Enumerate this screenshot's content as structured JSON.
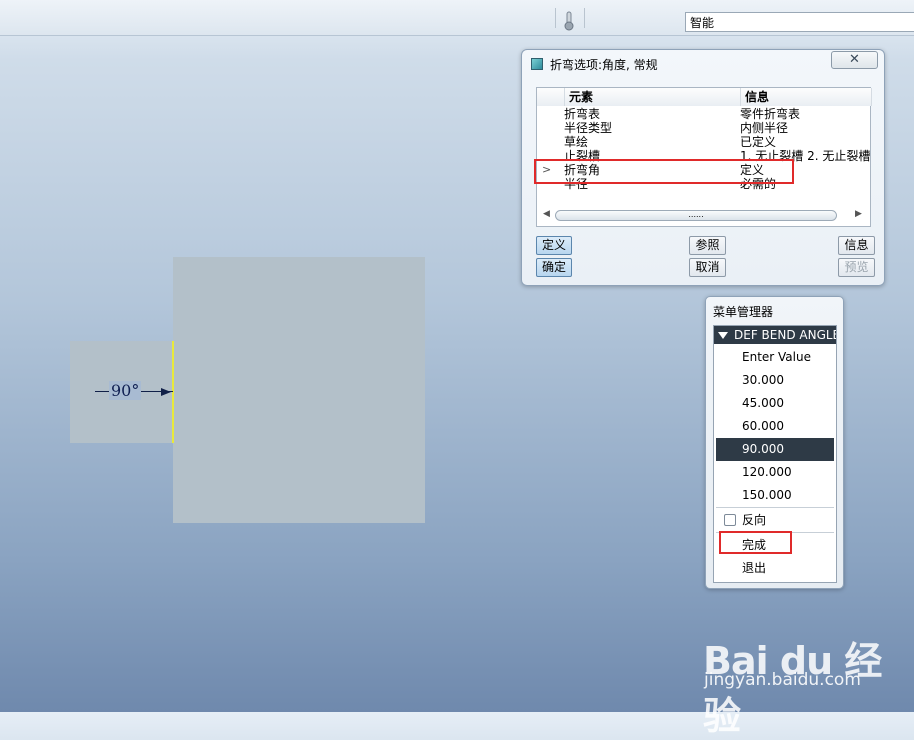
{
  "toolbar": {
    "filter_value": "智能",
    "thermometer_icon": "thermometer-icon"
  },
  "viewport": {
    "dimension_text": "90°"
  },
  "bend_dialog": {
    "title": "折弯选项:角度, 常规",
    "close_glyph": "✕",
    "columns": [
      "元素",
      "信息"
    ],
    "rows": [
      {
        "element": "折弯表",
        "info": "零件折弯表",
        "marker": ""
      },
      {
        "element": "半径类型",
        "info": "内侧半径",
        "marker": ""
      },
      {
        "element": "草绘",
        "info": "已定义",
        "marker": ""
      },
      {
        "element": "止裂槽",
        "info": "1. 无止裂槽 2. 无止裂槽",
        "marker": ""
      },
      {
        "element": "折弯角",
        "info": "定义",
        "marker": ">"
      },
      {
        "element": "半径",
        "info": "必需的",
        "marker": ""
      }
    ],
    "scroll_grip": "......",
    "buttons": {
      "define": "定义",
      "reference": "参照",
      "info": "信息",
      "ok": "确定",
      "cancel": "取消",
      "preview": "预览"
    }
  },
  "menu_manager": {
    "title": "菜单管理器",
    "header": "DEF BEND ANGLE",
    "items": [
      "Enter Value",
      "30.000",
      "45.000",
      "60.000",
      "90.000",
      "120.000",
      "150.000"
    ],
    "selected_item": "90.000",
    "flip_label": "反向",
    "flip_checked": false,
    "done_label": "完成",
    "quit_label": "退出"
  },
  "watermark": {
    "logo": "Bai du 经验",
    "url": "jingyan.baidu.com"
  },
  "colors": {
    "highlight": "#e02a2a",
    "menu_dark": "#2e3a46",
    "model_plate": "#b3c0c9",
    "edge_yellow": "#e9e93a"
  }
}
